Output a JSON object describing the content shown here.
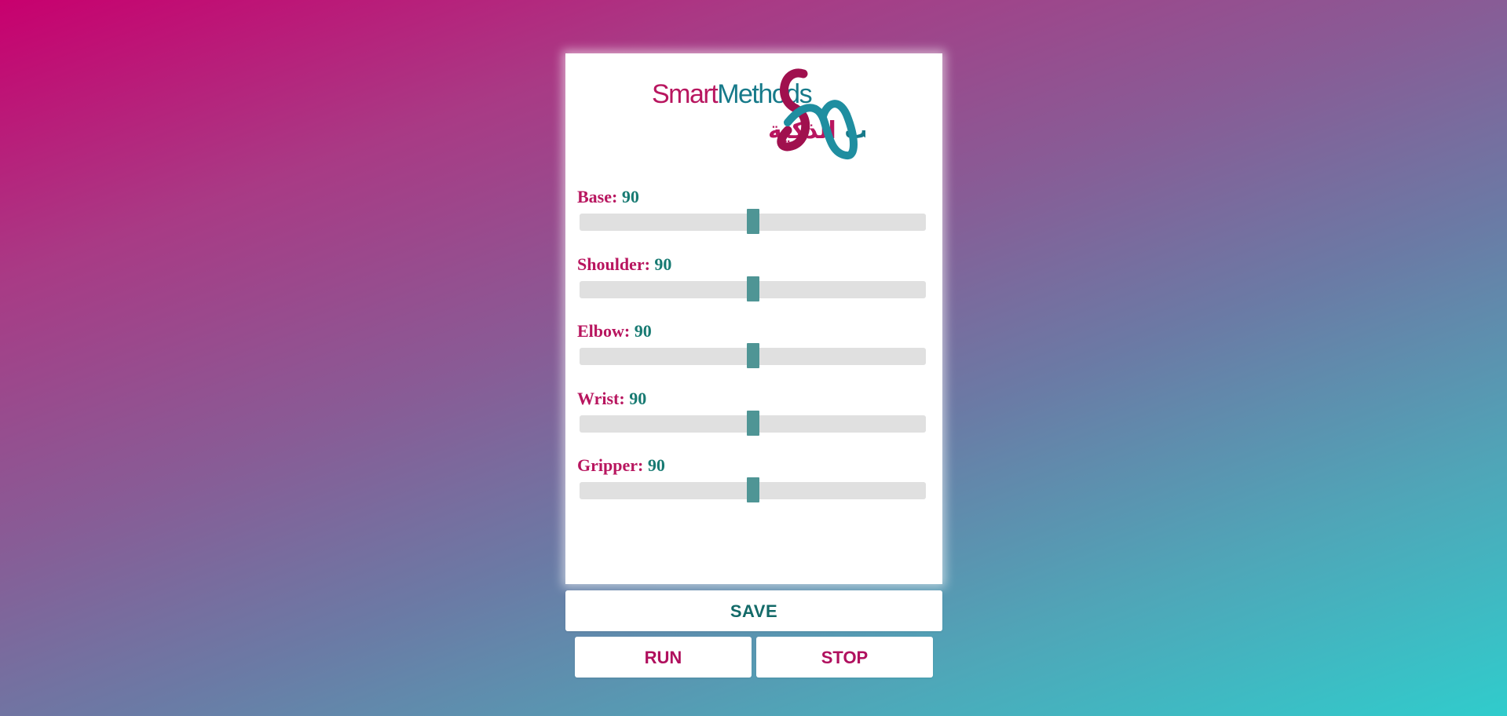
{
  "logo": {
    "text_en": "SmartMethods",
    "text_ar": "الأساليب الذكية"
  },
  "sliders": [
    {
      "label": "Base:",
      "value": "90",
      "fraction": 0.5
    },
    {
      "label": "Shoulder:",
      "value": "90",
      "fraction": 0.5
    },
    {
      "label": "Elbow:",
      "value": "90",
      "fraction": 0.5
    },
    {
      "label": "Wrist:",
      "value": "90",
      "fraction": 0.5
    },
    {
      "label": "Gripper:",
      "value": "90",
      "fraction": 0.5
    }
  ],
  "buttons": {
    "save": "SAVE",
    "run": "RUN",
    "stop": "STOP"
  },
  "colors": {
    "accent_pink": "#b8165f",
    "accent_teal": "#177a72",
    "thumb": "#4f9595"
  }
}
